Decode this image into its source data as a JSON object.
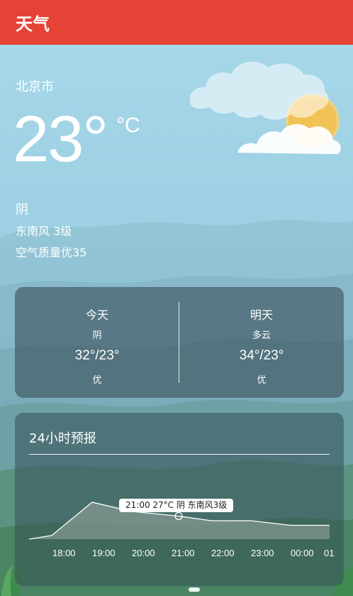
{
  "app": {
    "title": "天气"
  },
  "current": {
    "city": "北京市",
    "temperature": "23°",
    "unit": "°C",
    "condition": "阴",
    "wind": "东南风 3级",
    "air_quality": "空气质量优35"
  },
  "days": [
    {
      "name": "今天",
      "condition": "阴",
      "range": "32°/23°",
      "aqi": "优"
    },
    {
      "name": "明天",
      "condition": "多云",
      "range": "34°/23°",
      "aqi": "优"
    }
  ],
  "hourly": {
    "title": "24小时预报",
    "tooltip": "21:00 27°C 阴 东南风3级",
    "selected_index": 3,
    "labels": [
      "18:00",
      "19:00",
      "20:00",
      "21:00",
      "22:00",
      "23:00",
      "00:00",
      "01"
    ],
    "temps": [
      22,
      30,
      28,
      27,
      26,
      26,
      25,
      25
    ],
    "line_color": "#ffffff",
    "fill_color": "#9aa89e"
  },
  "colors": {
    "titlebar": "#e64235"
  },
  "icons": {
    "weather": "sun-behind-cloud-icon"
  }
}
